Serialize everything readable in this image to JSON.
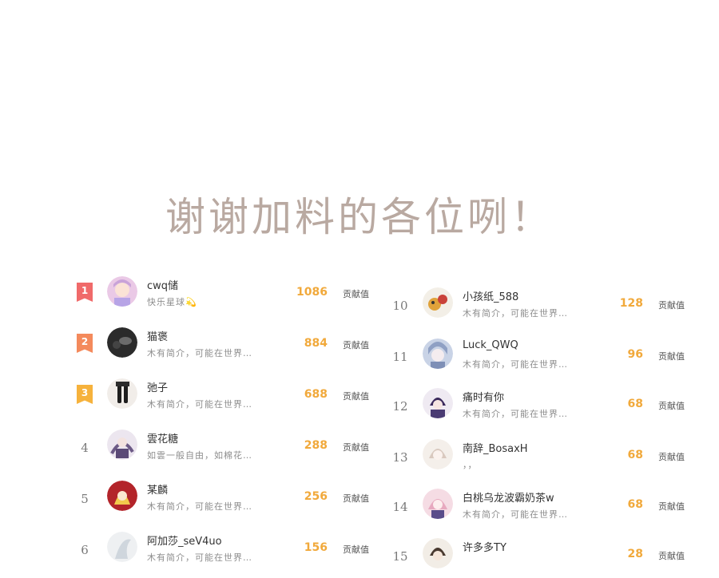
{
  "title": "谢谢加料的各位咧！",
  "unit_label": "贡献值",
  "left": [
    {
      "rank": "1",
      "name": "cwq储",
      "bio": "快乐星球💫",
      "score": "1086"
    },
    {
      "rank": "2",
      "name": "猫褒",
      "bio": "木有简介，可能在世界…",
      "score": "884"
    },
    {
      "rank": "3",
      "name": "弛子",
      "bio": "木有简介，可能在世界…",
      "score": "688"
    },
    {
      "rank": "4",
      "name": "雲花糖",
      "bio": "如雲一般自由，如棉花…",
      "score": "288"
    },
    {
      "rank": "5",
      "name": "某麟",
      "bio": "木有简介，可能在世界…",
      "score": "256"
    },
    {
      "rank": "6",
      "name": "阿加莎_seV4uo",
      "bio": "木有简介，可能在世界…",
      "score": "156"
    }
  ],
  "right": [
    {
      "rank": "10",
      "name": "小孩纸_588",
      "bio": "木有简介，可能在世界…",
      "score": "128"
    },
    {
      "rank": "11",
      "name": "Luck_QWQ",
      "bio": "木有简介，可能在世界…",
      "score": "96"
    },
    {
      "rank": "12",
      "name": "痛时有你",
      "bio": "木有简介，可能在世界…",
      "score": "68"
    },
    {
      "rank": "13",
      "name": "南辞_BosaxH",
      "bio": "，，",
      "score": "68"
    },
    {
      "rank": "14",
      "name": "白桃乌龙波霸奶茶w",
      "bio": "木有简介，可能在世界…",
      "score": "68"
    },
    {
      "rank": "15",
      "name": "许多多TY",
      "bio": "",
      "score": "28"
    }
  ],
  "colors": {
    "title": "#b9a9a1",
    "score": "#f1a93b",
    "rank1": "#f06a6a",
    "rank2": "#f48a5c",
    "rank3": "#f6b23c"
  }
}
